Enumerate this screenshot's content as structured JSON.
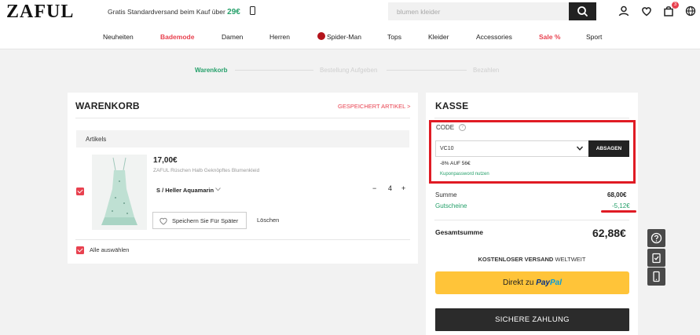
{
  "header": {
    "logo": "ZAFUL",
    "promo_text": "Gratis Standardversand beim Kauf über",
    "promo_price": "29€",
    "search_placeholder": "blumen kleider",
    "cart_count": "3"
  },
  "nav": [
    {
      "label": "Neuheiten",
      "highlight": false
    },
    {
      "label": "Bademode",
      "highlight": true
    },
    {
      "label": "Damen",
      "highlight": false
    },
    {
      "label": "Herren",
      "highlight": false
    },
    {
      "label": "Spider-Man",
      "highlight": false
    },
    {
      "label": "Tops",
      "highlight": false
    },
    {
      "label": "Kleider",
      "highlight": false
    },
    {
      "label": "Accessories",
      "highlight": false
    },
    {
      "label": "Sale %",
      "highlight": true
    },
    {
      "label": "Sport",
      "highlight": false
    }
  ],
  "steps": [
    {
      "label": "Warenkorb",
      "active": true
    },
    {
      "label": "Bestellung Aufgeben",
      "active": false
    },
    {
      "label": "Bezahlen",
      "active": false
    }
  ],
  "cart": {
    "title": "WARENKORB",
    "saved_link": "GESPEICHERT ARTIKEL >",
    "column_header": "Artikels",
    "item": {
      "price": "17,00€",
      "name": "ZAFUL Rüschen Halb Geknöpftes Blumenkleid",
      "variant": "S / Heller Aquamarin",
      "quantity": "4",
      "minus": "−",
      "plus": "+",
      "checked": true
    },
    "save_later": "Speichern Sie Für Später",
    "delete": "Löschen",
    "select_all": "Alle auswählen"
  },
  "checkout": {
    "title": "KASSE",
    "code_label": "CODE",
    "code_help": "?",
    "code_value": "VC10",
    "apply_button": "ABSAGEN",
    "discount_text": "-8% AUF 56€",
    "password_link": "Kuponpassword nutzen",
    "sum_label": "Summe",
    "sum_value": "68,00€",
    "voucher_label": "Gutscheine",
    "voucher_value": "-5,12€",
    "total_label": "Gesamtsumme",
    "total_value": "62,88€",
    "shipping_bold": "KOSTENLOSER VERSAND",
    "shipping_rest": "WELTWEIT",
    "paypal_prefix": "Direkt zu",
    "paypal_brand_1": "Pay",
    "paypal_brand_2": "Pal",
    "pay_button": "SICHERE ZAHLUNG"
  },
  "colors": {
    "accent_red": "#e8414f",
    "accent_green": "#25a06a",
    "paypal_yellow": "#ffc439",
    "annotation_red": "#e01b24"
  },
  "side_icons": [
    "help-icon",
    "clipboard-icon",
    "mobile-icon"
  ]
}
